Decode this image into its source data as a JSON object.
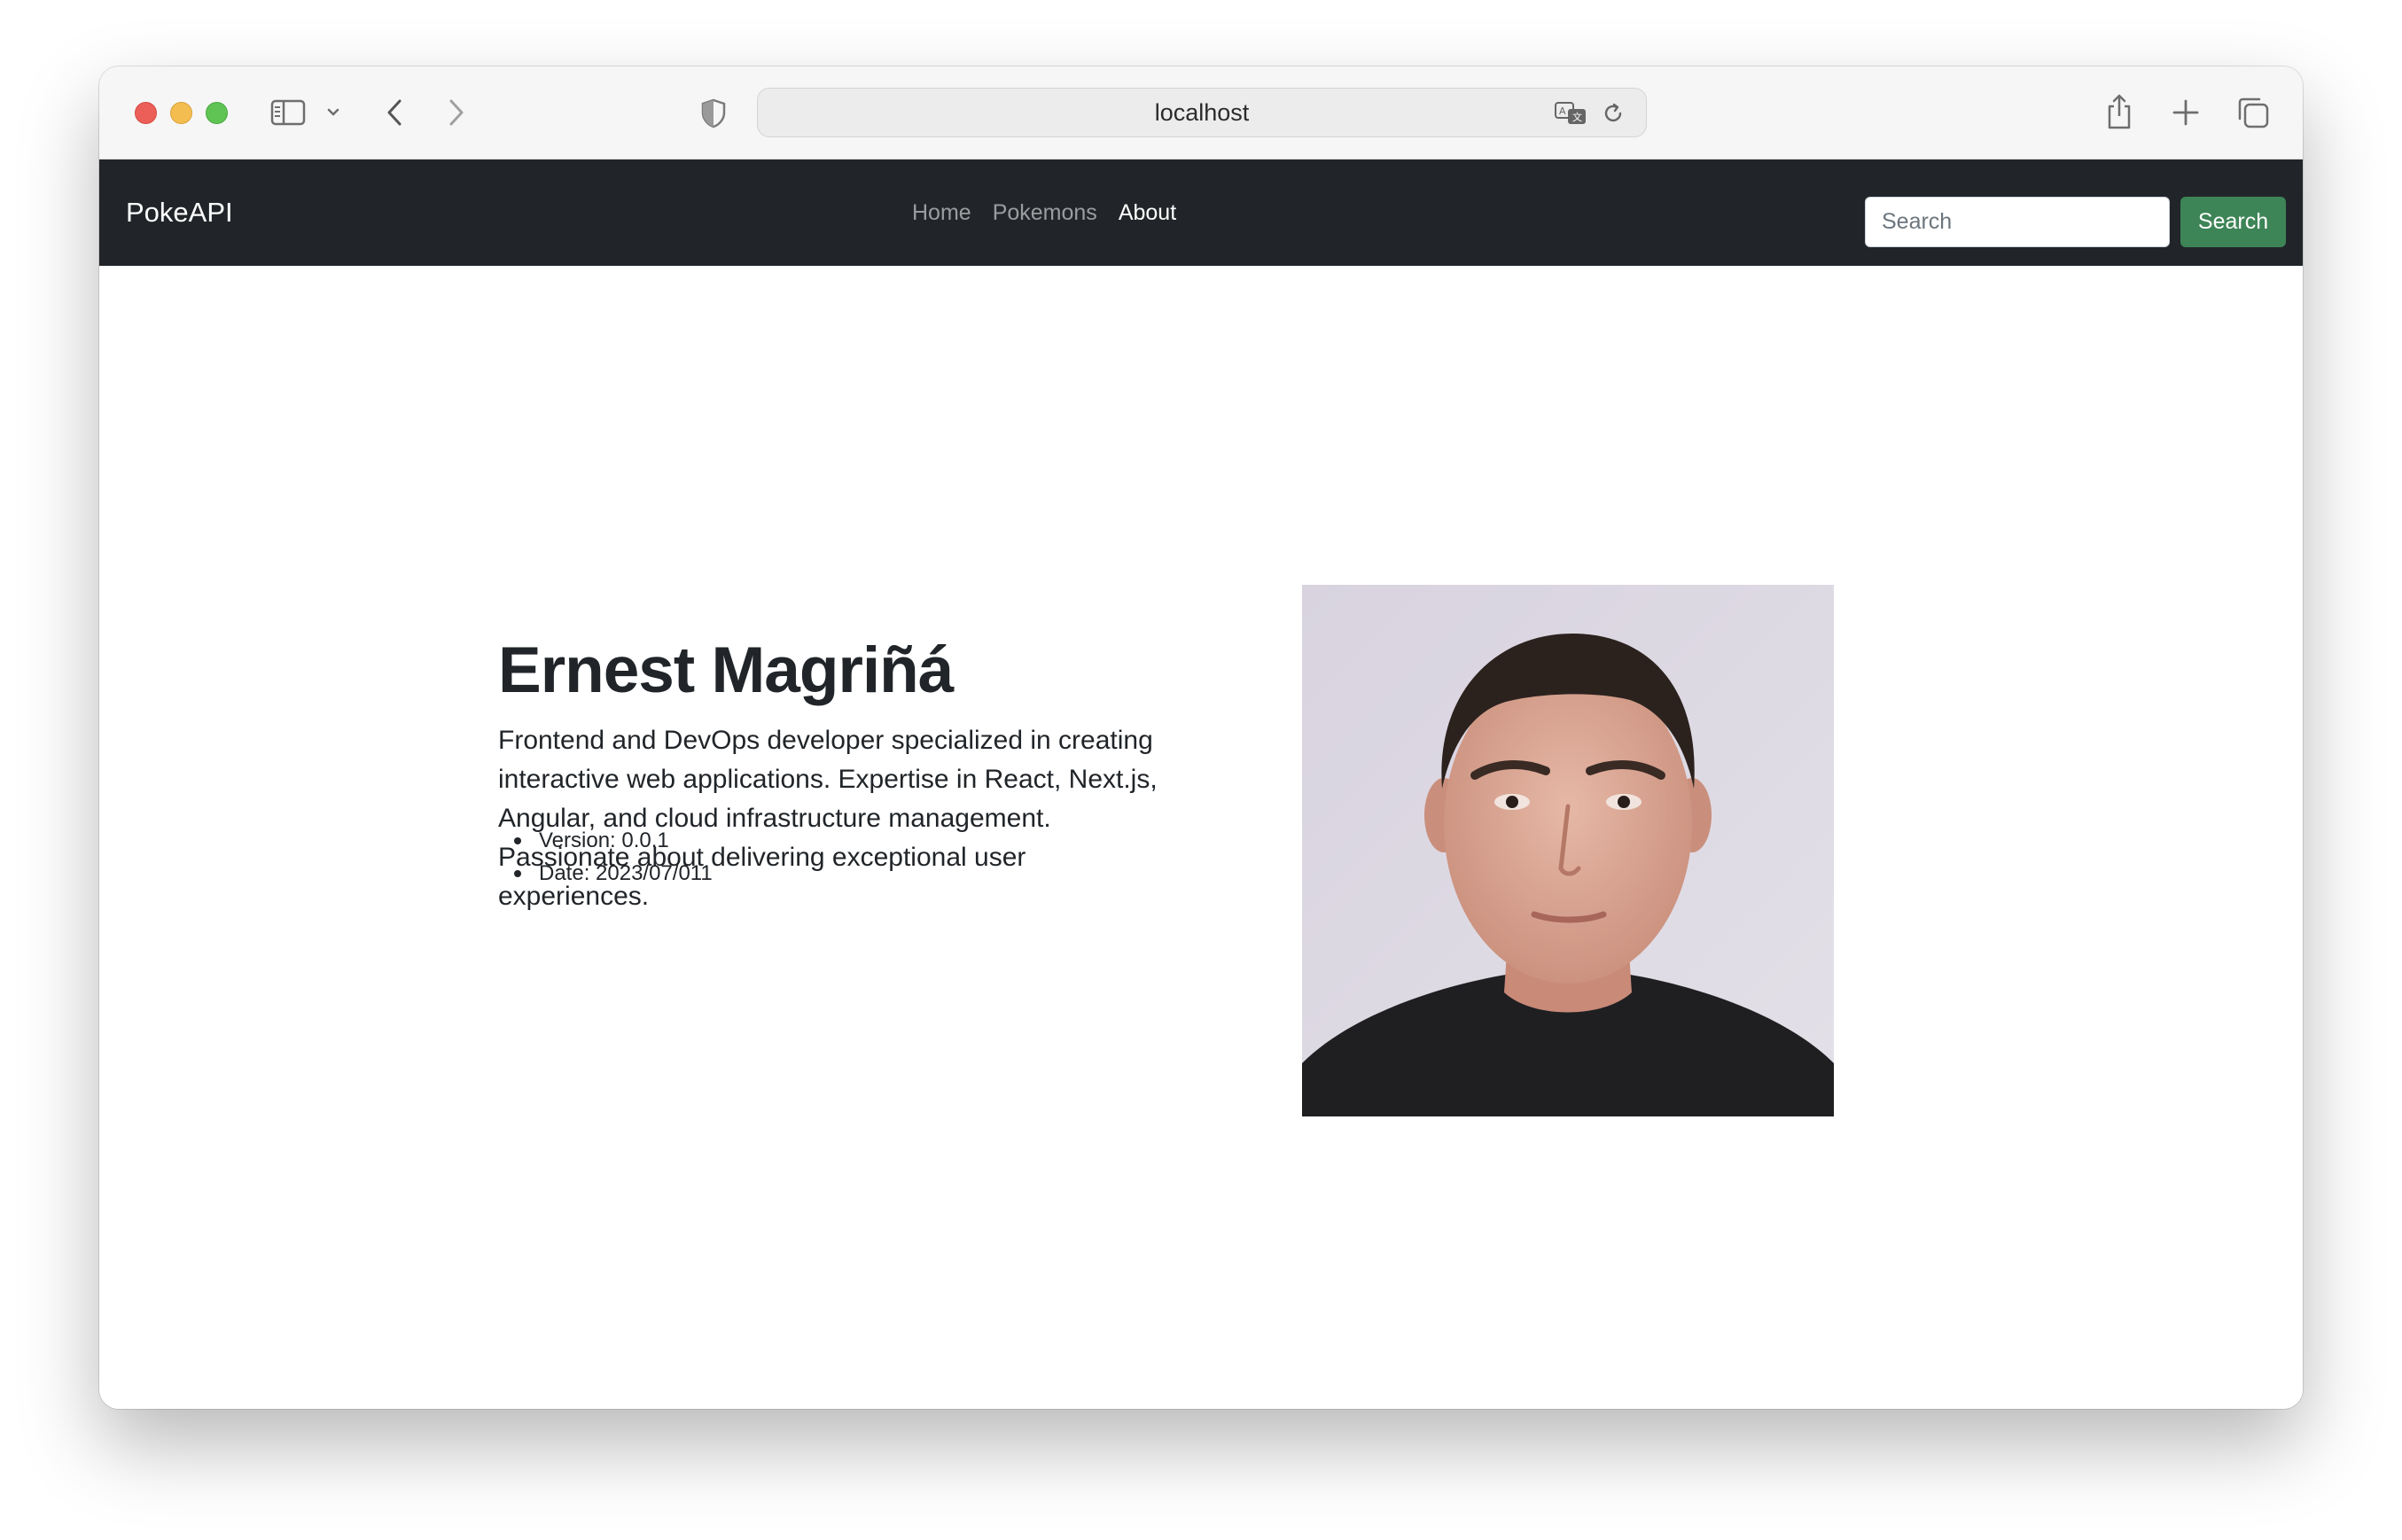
{
  "browser": {
    "url": "localhost"
  },
  "navbar": {
    "brand": "PokeAPI",
    "links": [
      {
        "label": "Home",
        "active": false
      },
      {
        "label": "Pokemons",
        "active": false
      },
      {
        "label": "About",
        "active": true
      }
    ],
    "search": {
      "placeholder": "Search",
      "value": "",
      "button_label": "Search"
    }
  },
  "about": {
    "name": "Ernest Magriñá",
    "bio": "Frontend and DevOps developer specialized in creating interactive web applications. Expertise in React, Next.js, Angular, and cloud infrastructure management. Passionate about delivering exceptional user experiences.",
    "meta": [
      "Version: 0.0.1",
      "Date: 2023/07/011"
    ]
  },
  "colors": {
    "navbar_bg": "#212529",
    "search_button": "#3d8456"
  }
}
